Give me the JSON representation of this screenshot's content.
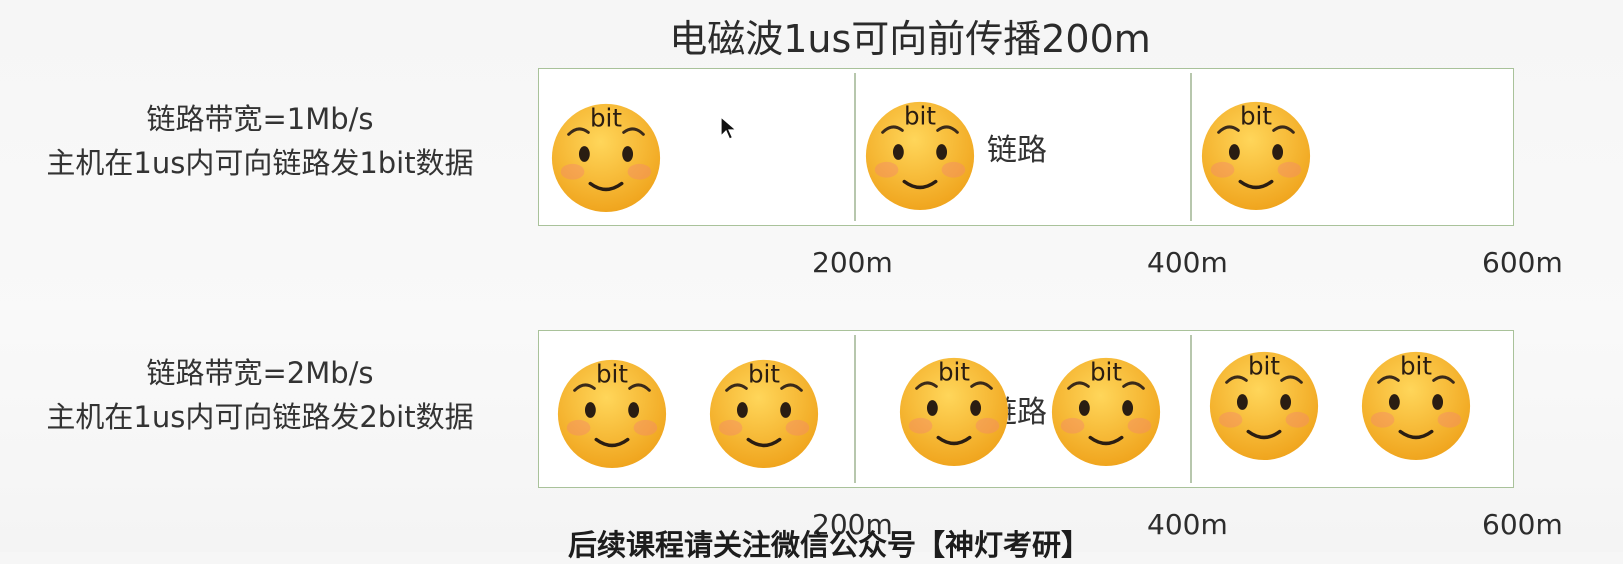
{
  "title": "电磁波1us可向前传播200m",
  "rows": [
    {
      "bandwidth": "链路带宽=1Mb/s",
      "host_rate": "主机在1us内可向链路发1bit数据",
      "link_label": "链路",
      "bits": [
        "bit",
        "bit",
        "bit"
      ]
    },
    {
      "bandwidth": "链路带宽=2Mb/s",
      "host_rate": "主机在1us内可向链路发2bit数据",
      "link_label": "链路",
      "bits": [
        "bit",
        "bit",
        "bit",
        "bit",
        "bit",
        "bit"
      ]
    }
  ],
  "distance_markers": [
    "200m",
    "400m",
    "600m"
  ],
  "watermark": "后续课程请关注微信公众号【神灯考研】",
  "colors": {
    "face": "#f7b52b",
    "box_border": "#a9c29a"
  },
  "icons": [
    "smiley-bit-icon",
    "mouse-cursor-icon"
  ]
}
